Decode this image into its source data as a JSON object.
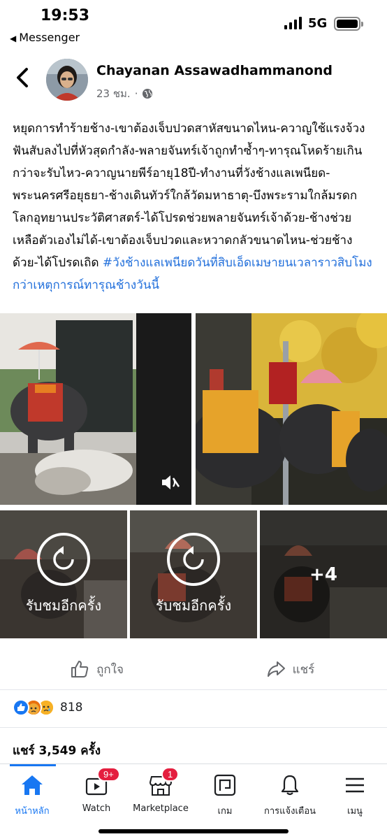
{
  "status_bar": {
    "time": "19:53",
    "back_app": "Messenger",
    "network": "5G"
  },
  "post": {
    "author": "Chayanan Assawadhammanond",
    "time_ago": "23 ชม.",
    "separator": "·",
    "privacy_icon": "globe-icon",
    "text_body": "หยุดการทำร้ายช้าง-เขาต้องเจ็บปวดสาหัสขนาดไหน-ควาญใช้แรงจ้วงฟันสับลงไปที่หัวสุดกำลัง-พลายจันทร์เจ้าถูกทำซ้ำๆ-ทารุณโหดร้ายเกินกว่าจะรับไหว-ควาญนายพีร์อายุ18ปี-ทำงานที่วังช้างแลเพนียด-พระนครศรีอยุธยา-ช้างเดินทัวร์ใกล้วัดมหาธาตุ-บึงพระรามใกล้มรดกโลกอุทยานประวัติศาสตร์-ได้โปรดช่วยพลายจันทร์เจ้าด้วย-ช้างช่วยเหลือตัวเองไม่ได้-เขาต้องเจ็บปวดและหวาดกลัวขนาดไหน-ช่วยช้างด้วย-ได้โปรดเถิด ",
    "hashtag": "#วังช้างแลเพนียดวันที่สิบเอ็ดเมษายนเวลาราวสิบโมงกว่าเหตุการณ์ทารุณช้างวันนี้",
    "media": {
      "replay_label_1": "รับชมอีกครั้ง",
      "replay_label_2": "รับชมอีกครั้ง",
      "more_count": "+4"
    },
    "actions": {
      "like": "ถูกใจ",
      "share": "แชร์"
    },
    "reaction_count": "818",
    "share_count_text": "แชร์ 3,549 ครั้ง"
  },
  "tab_bar": {
    "tabs": [
      {
        "label": "หน้าหลัก",
        "icon": "home-icon",
        "active": true
      },
      {
        "label": "Watch",
        "icon": "watch-icon",
        "badge": "9+"
      },
      {
        "label": "Marketplace",
        "icon": "marketplace-icon",
        "badge": "1"
      },
      {
        "label": "เกม",
        "icon": "gaming-icon"
      },
      {
        "label": "การแจ้งเตือน",
        "icon": "bell-icon"
      },
      {
        "label": "เมนู",
        "icon": "menu-icon"
      }
    ]
  },
  "colors": {
    "accent": "#1877f2",
    "hashtag": "#216fdb",
    "badge": "#e41e3f",
    "secondary_text": "#65676b"
  }
}
